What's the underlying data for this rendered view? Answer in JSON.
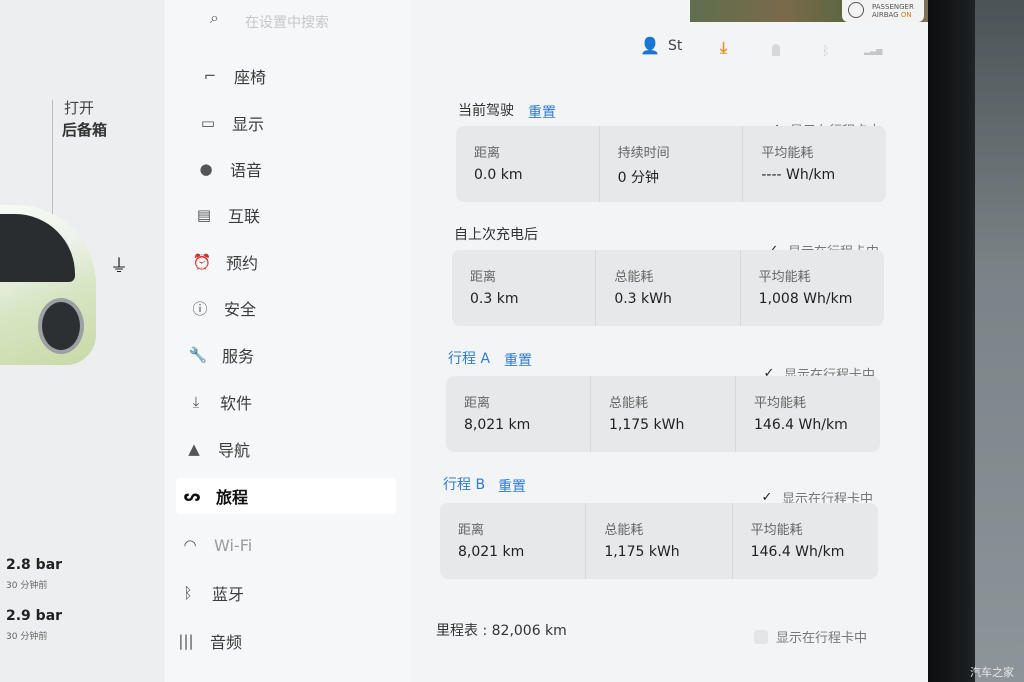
{
  "header": {
    "search_placeholder": "在设置中搜索",
    "user_name": "St",
    "airbag": {
      "line1": "PASSENGER",
      "line2": "AIRBAG",
      "status": "ON"
    }
  },
  "car_panel": {
    "trunk_open": "打开",
    "trunk_label": "后备箱",
    "tire_front": {
      "value": "2.8 bar",
      "sub": "30 分钟前"
    },
    "tire_rear": {
      "value": "2.9 bar",
      "sub": "30 分钟前"
    }
  },
  "menu": {
    "items": [
      {
        "label": "座椅",
        "icon": "seat-icon",
        "glyph": "⌐"
      },
      {
        "label": "显示",
        "icon": "display-icon",
        "glyph": "▭"
      },
      {
        "label": "语音",
        "icon": "microphone-icon",
        "glyph": "●"
      },
      {
        "label": "互联",
        "icon": "connectivity-icon",
        "glyph": "▤"
      },
      {
        "label": "预约",
        "icon": "alarm-clock-icon",
        "glyph": "⏰"
      },
      {
        "label": "安全",
        "icon": "safety-icon",
        "glyph": "ⓘ"
      },
      {
        "label": "服务",
        "icon": "wrench-icon",
        "glyph": "🔧"
      },
      {
        "label": "软件",
        "icon": "download-icon",
        "glyph": "⤓"
      },
      {
        "label": "导航",
        "icon": "navigation-icon",
        "glyph": "▲"
      },
      {
        "label": "旅程",
        "icon": "trips-icon",
        "glyph": "ᔕ",
        "active": true
      },
      {
        "label": "Wi-Fi",
        "icon": "wifi-icon",
        "glyph": "◠"
      },
      {
        "label": "蓝牙",
        "icon": "bluetooth-icon",
        "glyph": "ᛒ"
      },
      {
        "label": "音频",
        "icon": "audio-icon",
        "glyph": "|||"
      }
    ]
  },
  "trips": {
    "show_in_card_label": "显示在行程卡中",
    "reset_label": "重置",
    "current": {
      "title": "当前驾驶",
      "checked": true,
      "cells": [
        {
          "label": "距离",
          "value": "0.0  km"
        },
        {
          "label": "持续时间",
          "value": "0  分钟"
        },
        {
          "label": "平均能耗",
          "value": "----  Wh/km"
        }
      ]
    },
    "since_charge": {
      "title": "自上次充电后",
      "checked": true,
      "cells": [
        {
          "label": "距离",
          "value": "0.3  km"
        },
        {
          "label": "总能耗",
          "value": "0.3  kWh"
        },
        {
          "label": "平均能耗",
          "value": "1,008  Wh/km"
        }
      ]
    },
    "trip_a": {
      "title": "行程 A",
      "checked": true,
      "cells": [
        {
          "label": "距离",
          "value": "8,021  km"
        },
        {
          "label": "总能耗",
          "value": "1,175  kWh"
        },
        {
          "label": "平均能耗",
          "value": "146.4  Wh/km"
        }
      ]
    },
    "trip_b": {
      "title": "行程 B",
      "checked": true,
      "cells": [
        {
          "label": "距离",
          "value": "8,021  km"
        },
        {
          "label": "总能耗",
          "value": "1,175  kWh"
        },
        {
          "label": "平均能耗",
          "value": "146.4  Wh/km"
        }
      ]
    },
    "odometer": {
      "label": "里程表 :",
      "value": "82,006 km",
      "checked": false
    }
  },
  "watermark": "汽车之家",
  "colors": {
    "accent": "#2f7bd8",
    "download": "#e7922a"
  }
}
